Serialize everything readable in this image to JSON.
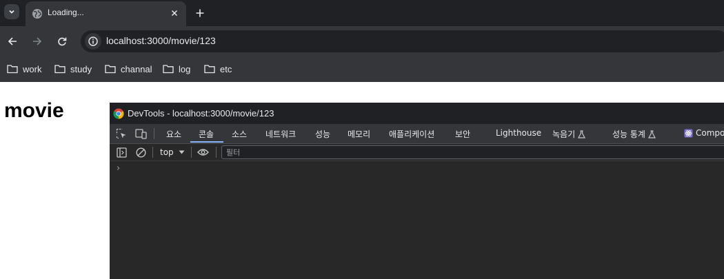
{
  "browser": {
    "tab": {
      "title": "Loading..."
    },
    "address": {
      "url": "localhost:3000/movie/123"
    },
    "bookmarks": [
      "work",
      "study",
      "channal",
      "log",
      "etc"
    ]
  },
  "page": {
    "heading": "movie"
  },
  "devtools": {
    "window_title": "DevTools - localhost:3000/movie/123",
    "tabs": [
      "요소",
      "콘솔",
      "소스",
      "네트워크",
      "성능",
      "메모리",
      "애플리케이션",
      "보안",
      "Lighthouse",
      "녹음기",
      "성능 통계",
      "Compo"
    ],
    "active_tab": "콘솔",
    "console": {
      "context": "top",
      "filter_placeholder": "필터",
      "prompt": "›"
    }
  }
}
